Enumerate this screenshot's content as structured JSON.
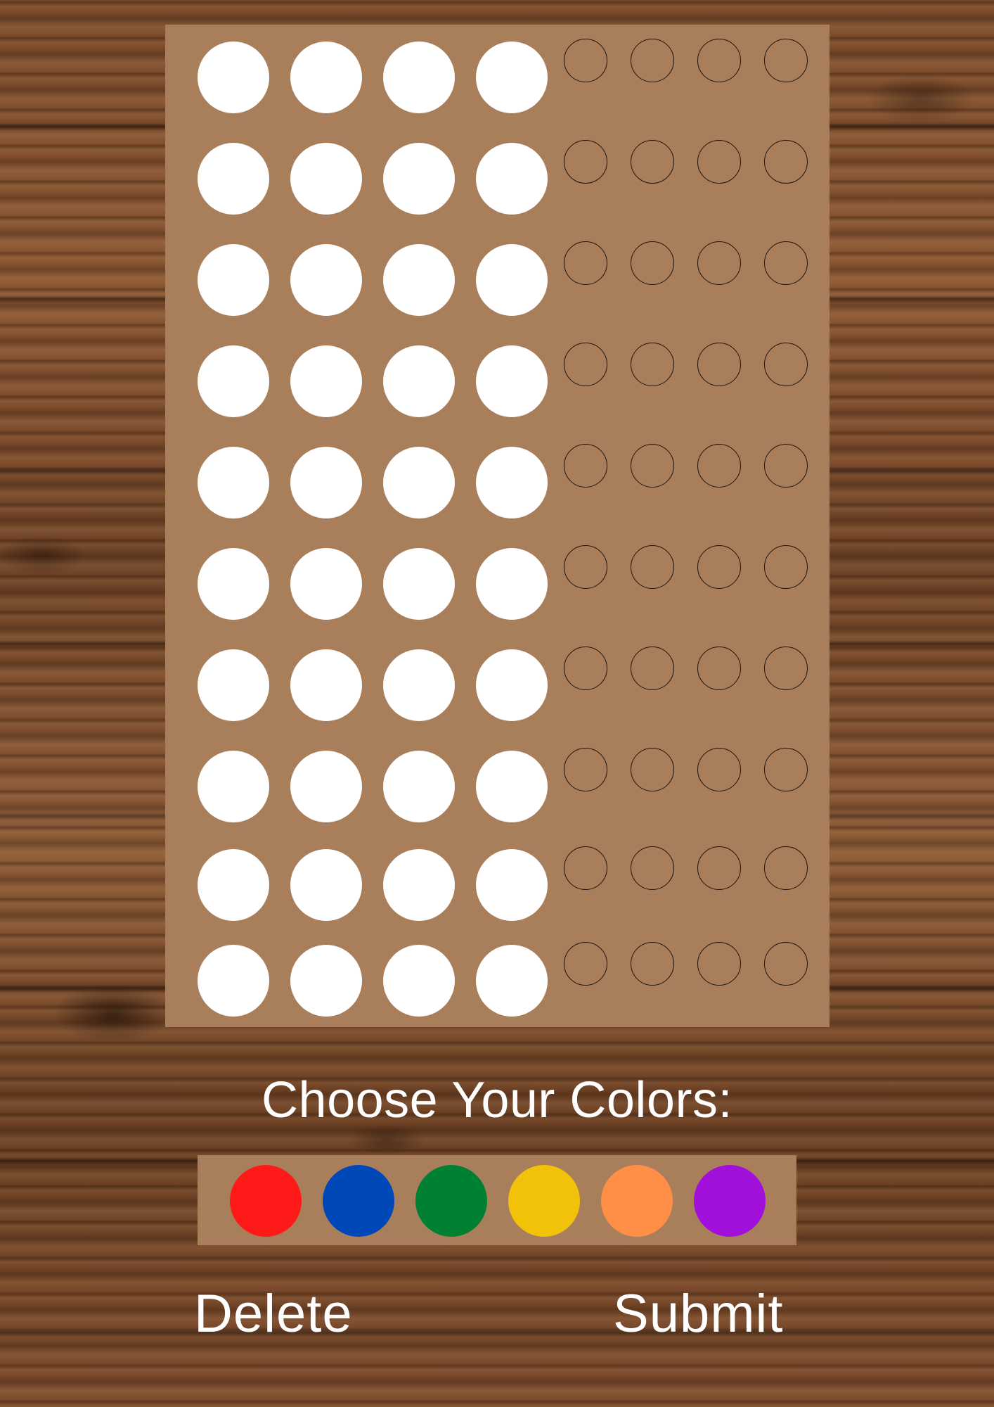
{
  "board": {
    "rows": 10,
    "pegs_per_row": 4,
    "hint_pegs_per_row": 4,
    "peg_color": "#ffffff",
    "board_color": "#a97e5b"
  },
  "prompt": "Choose Your Colors:",
  "palette": [
    {
      "name": "red",
      "color": "#ff1a1a"
    },
    {
      "name": "blue",
      "color": "#0047b8"
    },
    {
      "name": "green",
      "color": "#008033"
    },
    {
      "name": "yellow",
      "color": "#f2c20a"
    },
    {
      "name": "orange",
      "color": "#ff8f47"
    },
    {
      "name": "purple",
      "color": "#a10fdb"
    }
  ],
  "actions": {
    "delete_label": "Delete",
    "submit_label": "Submit"
  }
}
